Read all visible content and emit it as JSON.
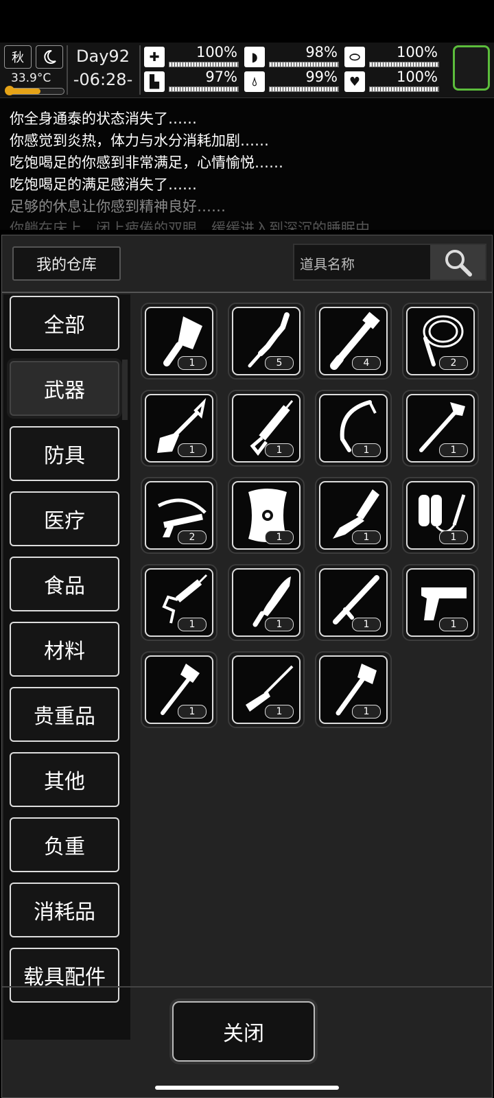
{
  "status": {
    "season": "秋",
    "temperature": "33.9°C",
    "temperature_fill": 0.6,
    "day": "Day92",
    "time": "-06:28-",
    "stats": [
      {
        "icon": "medkit-icon",
        "value": "100%"
      },
      {
        "icon": "stomach-icon",
        "value": "98%"
      },
      {
        "icon": "pill-icon",
        "value": "100%"
      },
      {
        "icon": "boot-icon",
        "value": "97%"
      },
      {
        "icon": "water-drop-icon",
        "value": "99%"
      },
      {
        "icon": "heart-icon",
        "value": "100%"
      }
    ],
    "accent_color": "#5cbd3c"
  },
  "log": [
    {
      "text": "你全身通泰的状态消失了……",
      "color": "#ffffff"
    },
    {
      "text": "你感觉到炎热，体力与水分消耗加剧……",
      "color": "#ffffff"
    },
    {
      "text": "吃饱喝足的你感到非常满足，心情愉悦……",
      "color": "#ffffff"
    },
    {
      "text": "吃饱喝足的满足感消失了……",
      "color": "#ffffff"
    },
    {
      "text": "足够的休息让你感到精神良好……",
      "color": "#8a8a8a"
    },
    {
      "text": "你躺在床上，闭上疲倦的双眼，缓缓进入到深沉的睡眠中",
      "color": "#555555"
    }
  ],
  "warehouse": {
    "title": "我的仓库",
    "search_placeholder": "道具名称"
  },
  "categories": [
    "全部",
    "武器",
    "防具",
    "医疗",
    "食品",
    "材料",
    "贵重品",
    "其他",
    "负重",
    "消耗品",
    "载具配件"
  ],
  "selected_category": "武器",
  "items": [
    {
      "name": "cleaver-icon",
      "count": "1"
    },
    {
      "name": "machete-icon",
      "count": "5"
    },
    {
      "name": "pipe-wrench-icon",
      "count": "4"
    },
    {
      "name": "whip-icon",
      "count": "2"
    },
    {
      "name": "shovel-icon",
      "count": "1"
    },
    {
      "name": "caulk-gun-icon",
      "count": "1"
    },
    {
      "name": "sickle-icon",
      "count": "1"
    },
    {
      "name": "fire-axe-icon",
      "count": "1"
    },
    {
      "name": "crossbow-icon",
      "count": "2"
    },
    {
      "name": "shield-icon",
      "count": "1"
    },
    {
      "name": "survival-knife-icon",
      "count": "1"
    },
    {
      "name": "flamethrower-icon",
      "count": "1"
    },
    {
      "name": "syringe-gun-icon",
      "count": "1"
    },
    {
      "name": "kukri-icon",
      "count": "1"
    },
    {
      "name": "baton-icon",
      "count": "1"
    },
    {
      "name": "pistol-icon",
      "count": "1"
    },
    {
      "name": "war-axe-icon",
      "count": "1"
    },
    {
      "name": "rifle-icon",
      "count": "1"
    },
    {
      "name": "hatchet-icon",
      "count": "1"
    }
  ],
  "close_label": "关闭"
}
